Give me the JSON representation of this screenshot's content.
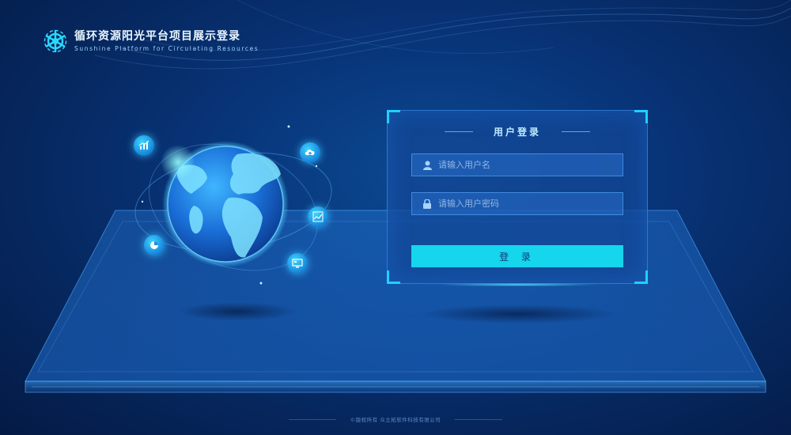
{
  "header": {
    "title_cn": "循环资源阳光平台项目展示登录",
    "title_en": "Sunshine Platform for Circulating Resources"
  },
  "login": {
    "title": "用户登录",
    "username_placeholder": "请输入用户名",
    "password_placeholder": "请输入用户密码",
    "submit_label": "登 录"
  },
  "globe_icons": [
    "bar-chart-icon",
    "cloud-upload-icon",
    "line-chart-icon",
    "pie-chart-icon",
    "monitor-icon"
  ],
  "footer": {
    "copyright": "©版权所有  众立拓软件科技有限公司"
  },
  "colors": {
    "accent": "#15d6ec",
    "panel_border": "#1fd0ff",
    "background": "#08357a"
  }
}
